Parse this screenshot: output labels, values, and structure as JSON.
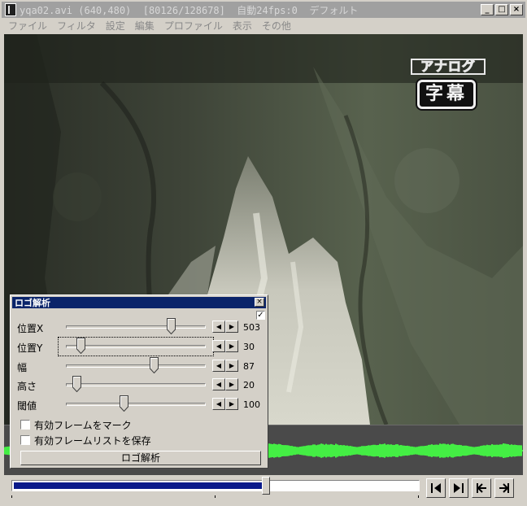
{
  "window": {
    "title": "yqa02.avi (640,480)  [80126/128678]  自動24fps:0  デフォルト",
    "buttons": {
      "minimize": "_",
      "maximize": "□",
      "close": "×"
    }
  },
  "menu": [
    "ファイル",
    "フィルタ",
    "設定",
    "編集",
    "プロファイル",
    "表示",
    "その他"
  ],
  "video": {
    "badge_analog": "アナログ",
    "badge_subtitle": "字幕"
  },
  "dialog": {
    "title": "ロゴ解析",
    "close": "×",
    "top_check": "✓",
    "sliders": [
      {
        "label": "位置X",
        "value": "503",
        "fraction": 0.77
      },
      {
        "label": "位置Y",
        "value": "30",
        "fraction": 0.08
      },
      {
        "label": "幅",
        "value": "87",
        "fraction": 0.64
      },
      {
        "label": "高さ",
        "value": "20",
        "fraction": 0.05
      },
      {
        "label": "閾値",
        "value": "100",
        "fraction": 0.41
      }
    ],
    "spin_left": "◀",
    "spin_right": "▶",
    "checkboxes": [
      {
        "label": "有効フレームをマーク",
        "checked": false
      },
      {
        "label": "有効フレームリストを保存",
        "checked": false
      }
    ],
    "analyze_button": "ロゴ解析"
  },
  "seek": {
    "current_frame": 80126,
    "total_frames": 128678
  },
  "colors": {
    "seek_fill": "#0a1a8a",
    "waveform": "#44ee44",
    "dialog_title": "#0a246a"
  }
}
